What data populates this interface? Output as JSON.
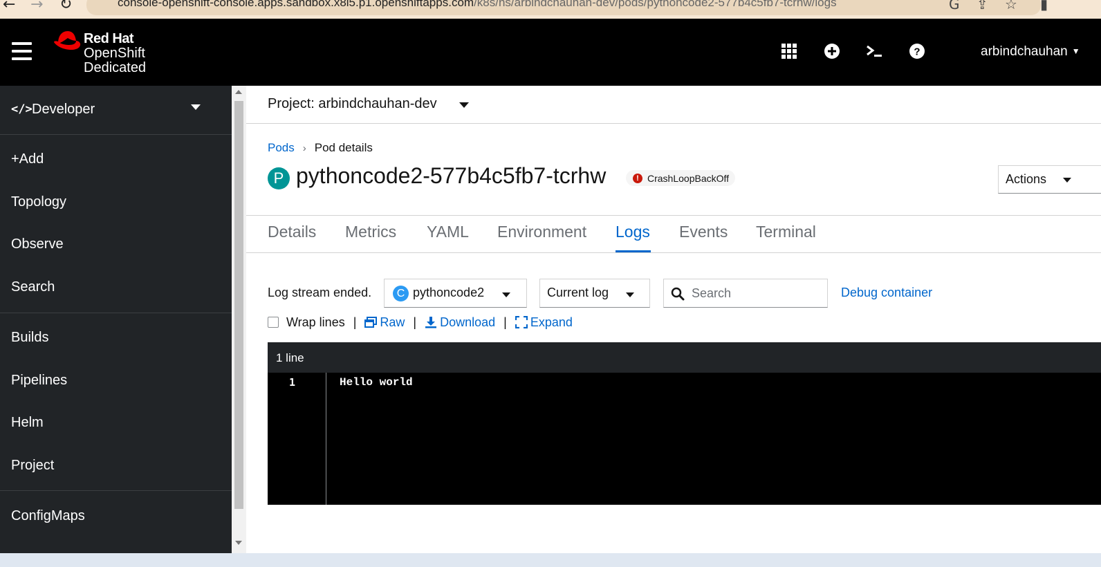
{
  "browser": {
    "url_host": "console-openshift-console.apps.sandbox.x8i5.p1.openshiftapps.com",
    "url_path": "/k8s/ns/arbindchauhan-dev/pods/pythoncode2-577b4c5fb7-tcrhw/logs"
  },
  "masthead": {
    "brand_line1": "Red Hat",
    "brand_line2": "OpenShift",
    "brand_line3": "Dedicated",
    "icons": [
      "apps-grid-icon",
      "plus-circle-icon",
      "terminal-icon",
      "help-icon"
    ],
    "username": "arbindchauhan"
  },
  "sidebar": {
    "perspective": "Developer",
    "items": [
      {
        "label": "+Add"
      },
      {
        "label": "Topology"
      },
      {
        "label": "Observe"
      },
      {
        "label": "Search"
      },
      {
        "label": "Builds"
      },
      {
        "label": "Pipelines"
      },
      {
        "label": "Helm"
      },
      {
        "label": "Project"
      },
      {
        "label": "ConfigMaps"
      }
    ]
  },
  "project_bar": {
    "label": "Project: arbindchauhan-dev"
  },
  "breadcrumb": {
    "parent": "Pods",
    "current": "Pod details"
  },
  "pod": {
    "badge": "P",
    "name": "pythoncode2-577b4c5fb7-tcrhw",
    "status": "CrashLoopBackOff",
    "actions_label": "Actions"
  },
  "tabs": [
    {
      "label": "Details"
    },
    {
      "label": "Metrics"
    },
    {
      "label": "YAML"
    },
    {
      "label": "Environment"
    },
    {
      "label": "Logs",
      "active": true
    },
    {
      "label": "Events"
    },
    {
      "label": "Terminal"
    }
  ],
  "logs": {
    "stream_status": "Log stream ended.",
    "container_badge": "C",
    "container": "pythoncode2",
    "log_type": "Current log",
    "search_placeholder": "Search",
    "debug_link": "Debug container",
    "wrap_label": "Wrap lines",
    "raw_label": "Raw",
    "download_label": "Download",
    "expand_label": "Expand",
    "line_count": "1 line",
    "lines": [
      {
        "num": "1",
        "text": "Hello world"
      }
    ]
  },
  "colors": {
    "masthead_bg": "#000000",
    "sidebar_bg": "#212427",
    "link": "#0066cc",
    "status_error": "#c9190b",
    "pod_badge": "#009596",
    "container_badge": "#2b9af3"
  }
}
